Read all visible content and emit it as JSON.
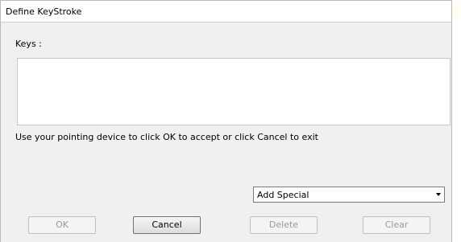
{
  "window": {
    "title": "Define KeyStroke"
  },
  "keys": {
    "label": "Keys :",
    "value": ""
  },
  "help_text": "Use your pointing device to click OK to accept or click Cancel to exit",
  "special_select": {
    "selected": "Add Special"
  },
  "buttons": {
    "ok": "OK",
    "cancel": "Cancel",
    "delete": "Delete",
    "clear": "Clear"
  }
}
